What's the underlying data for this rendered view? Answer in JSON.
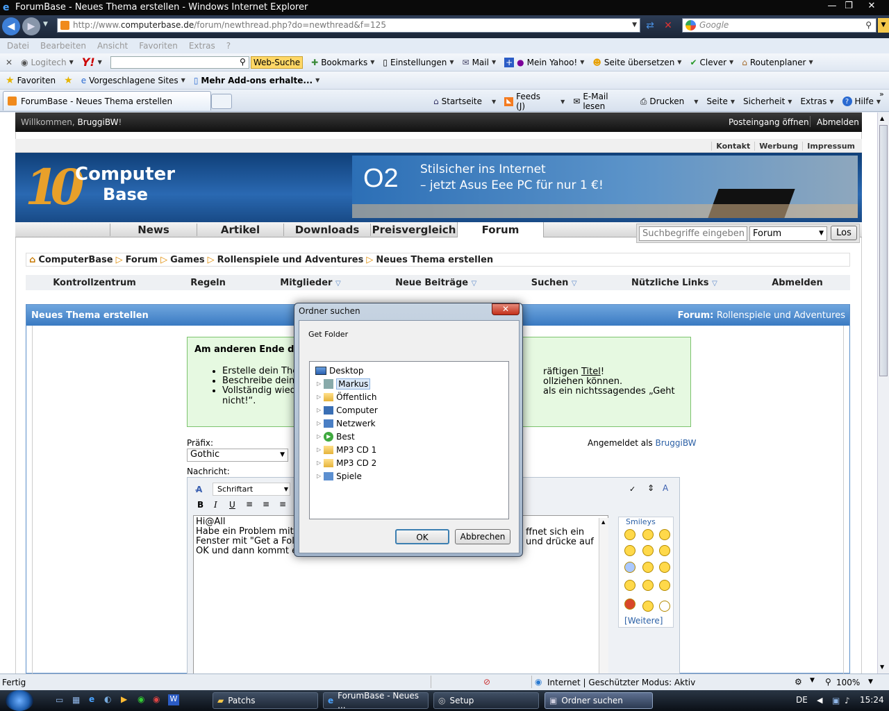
{
  "window": {
    "title": "ForumBase - Neues Thema erstellen - Windows Internet Explorer"
  },
  "address": {
    "prefix": "http://www.",
    "domain": "computerbase.de",
    "path": "/forum/newthread.php?do=newthread&f=125"
  },
  "search_box": {
    "placeholder": "Google"
  },
  "menu": [
    "Datei",
    "Bearbeiten",
    "Ansicht",
    "Favoriten",
    "Extras",
    "?"
  ],
  "toolbar1": {
    "logitech": "Logitech",
    "web_search": "Web-Suche",
    "bookmarks": "Bookmarks",
    "einstellungen": "Einstellungen",
    "mail": "Mail",
    "mein_yahoo": "Mein Yahoo!",
    "seite_uebersetzen": "Seite übersetzen",
    "clever": "Clever",
    "routenplaner": "Routenplaner"
  },
  "toolbar2": {
    "favoriten": "Favoriten",
    "vorgeschlagene": "Vorgeschlagene Sites",
    "addons": "Mehr Add-ons erhalte..."
  },
  "tab": {
    "label": "ForumBase - Neues Thema erstellen"
  },
  "commandbar": {
    "startseite": "Startseite",
    "feeds": "Feeds (J)",
    "email": "E-Mail lesen",
    "drucken": "Drucken",
    "seite": "Seite",
    "sicherheit": "Sicherheit",
    "extras": "Extras",
    "hilfe": "Hilfe"
  },
  "site": {
    "welcome": "Willkommen,",
    "user": "BruggiBW",
    "welcome_end": "!",
    "postbox": "Posteingang öffnen",
    "logout": "Abmelden",
    "top_links": [
      "Kontakt",
      "Werbung",
      "Impressum"
    ],
    "logo_number": "10",
    "logo_line1": "Computer",
    "logo_line2": "Base",
    "banner_brand": "O2",
    "banner_line1": "Stilsicher ins Internet",
    "banner_line2": "– jetzt Asus Eee PC für nur 1 €!",
    "nav": [
      "News",
      "Artikel",
      "Downloads",
      "Preisvergleich",
      "Forum"
    ],
    "search_placeholder": "Suchbegriffe eingeben",
    "search_scope": "Forum",
    "search_btn": "Los",
    "breadcrumb": [
      "ComputerBase",
      "Forum",
      "Games",
      "Rollenspiele und Adventures",
      "Neues Thema erstellen"
    ],
    "subnav": [
      "Kontrollzentrum",
      "Regeln",
      "Mitglieder",
      "Neue Beiträge",
      "Suchen",
      "Nützliche Links",
      "Abmelden"
    ],
    "panel_title": "Neues Thema erstellen",
    "panel_forum_label": "Forum:",
    "panel_forum": "Rollenspiele und Adventures",
    "notice_title": "Am anderen Ende der",
    "notice_items": [
      "Erstelle dein The",
      "Beschreibe dein",
      "Vollständig wied"
    ],
    "notice_right": [
      "räftigen",
      "Titel",
      "!",
      "ollziehen können.",
      "als ein nichtssagendes „Geht",
      "nicht!“."
    ],
    "prefix_label": "Präfix:",
    "prefix_value": "Gothic",
    "logged_in": "Angemeldet als",
    "logged_user": "BruggiBW",
    "message_label": "Nachricht:",
    "font_select": "Schriftart",
    "message_lines": [
      "Hi@All",
      "Habe ein Problem mit",
      "Fenster mit \"Get a Fold",
      "OK und dann kommt e"
    ],
    "message_right": [
      "ffnet sich ein",
      "und drücke auf"
    ],
    "smileys_title": "Smileys",
    "smileys_more": "Weitere"
  },
  "dialog": {
    "title": "Ordner suchen",
    "caption": "Get Folder",
    "tree": [
      "Desktop",
      "Markus",
      "Öffentlich",
      "Computer",
      "Netzwerk",
      "Best",
      "MP3 CD 1",
      "MP3 CD 2",
      "Spiele"
    ],
    "ok": "OK",
    "cancel": "Abbrechen"
  },
  "statusbar": {
    "left": "Fertig",
    "zone": "Internet | Geschützter Modus: Aktiv",
    "zoom": "100%"
  },
  "taskbar": {
    "tasks": [
      "Patchs",
      "ForumBase - Neues ...",
      "Setup",
      "Ordner suchen"
    ],
    "lang": "DE",
    "time": "15:24"
  }
}
